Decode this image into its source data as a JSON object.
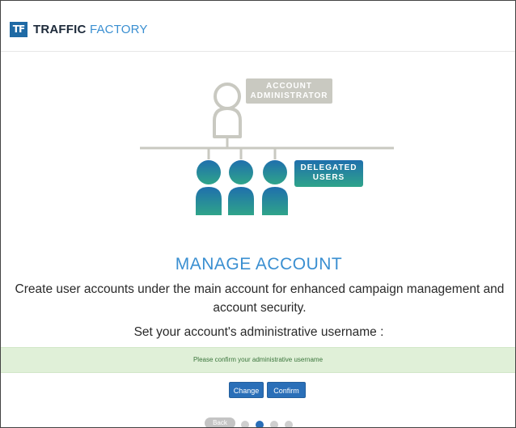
{
  "brand": {
    "logo_mark": "TF",
    "name_part1": "TRAFFIC",
    "name_part2": "FACTORY"
  },
  "illustration": {
    "admin_badge_line1": "ACCOUNT",
    "admin_badge_line2": "ADMINISTRATOR",
    "delegated_badge_line1": "DELEGATED",
    "delegated_badge_line2": "USERS"
  },
  "content": {
    "title": "MANAGE ACCOUNT",
    "description": "Create user accounts under the main account for enhanced campaign management and account security.",
    "prompt": "Set your account's administrative username :",
    "alert": "Please confirm your administrative username"
  },
  "actions": {
    "change_label": "Change",
    "confirm_label": "Confirm"
  },
  "wizard": {
    "back_label": "Back",
    "steps": [
      {
        "active": false
      },
      {
        "active": true
      },
      {
        "active": false
      },
      {
        "active": false
      }
    ]
  },
  "colors": {
    "brand_blue": "#1f6aa5",
    "accent_blue": "#3a8fd1",
    "admin_gray": "#c9c9c1",
    "user_gradient_top": "#1f6fad",
    "user_gradient_bottom": "#2fa48a",
    "alert_green_bg": "#e0f0d8",
    "button_blue": "#2a6fb8"
  },
  "icons": {
    "admin": "user-outline-icon",
    "delegated": "user-group-icon"
  }
}
